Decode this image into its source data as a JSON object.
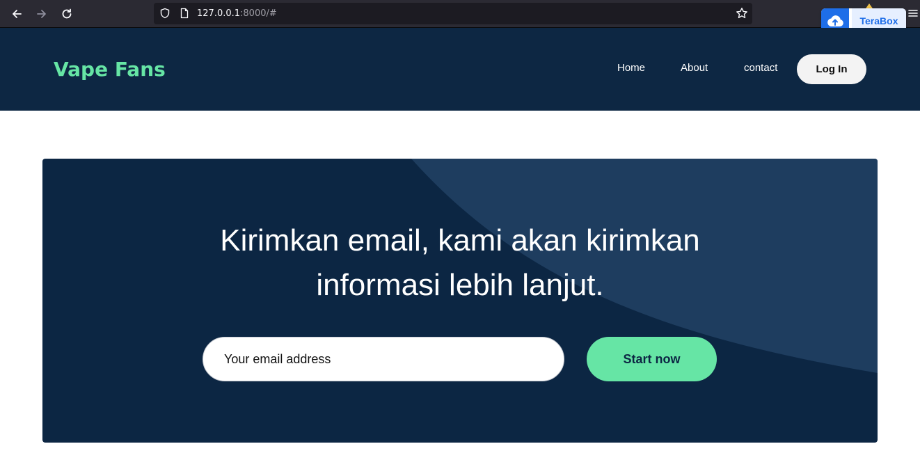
{
  "browser": {
    "url_host": "127.0.0.1",
    "url_rest": ":8000/#",
    "icons": [
      "back-icon",
      "forward-icon",
      "reload-icon",
      "shield-icon",
      "page-icon",
      "bookmark-star-icon",
      "menu-icon"
    ]
  },
  "extension": {
    "name": "TeraBox"
  },
  "header": {
    "brand": "Vape Fans",
    "nav": [
      {
        "label": "Home"
      },
      {
        "label": "About"
      },
      {
        "label": "contact"
      }
    ],
    "login_label": "Log In"
  },
  "cta": {
    "heading_line1": "Kirimkan email, kami akan kirimkan",
    "heading_line2": "informasi lebih lanjut.",
    "email_placeholder": "Your email address",
    "button_label": "Start now"
  },
  "colors": {
    "header_bg": "#0d2743",
    "panel_bg": "#0c2643",
    "panel_accent": "#1e3d5f",
    "brand_green": "#66e5a5"
  }
}
